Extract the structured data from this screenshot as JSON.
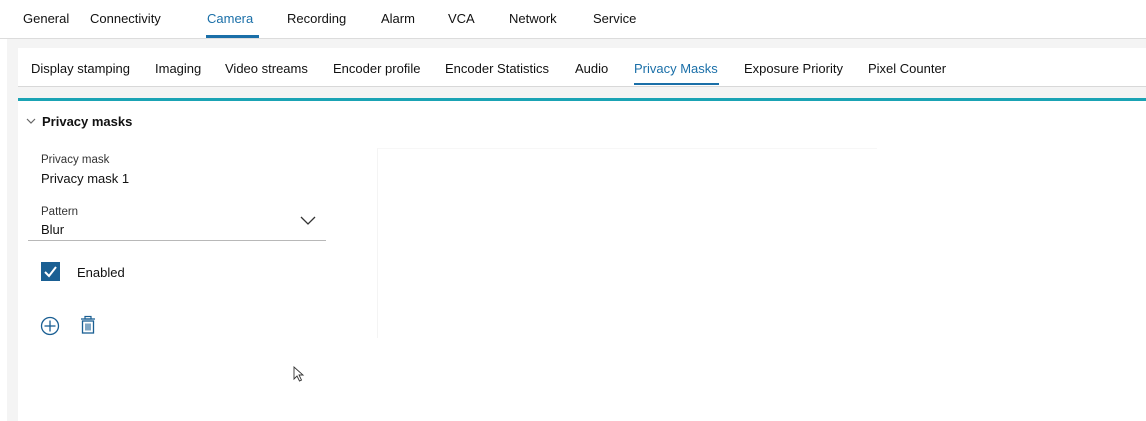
{
  "top_nav": {
    "tabs": [
      "General",
      "Connectivity",
      "Camera",
      "Recording",
      "Alarm",
      "VCA",
      "Network",
      "Service"
    ],
    "active": "Camera"
  },
  "sub_nav": {
    "tabs": [
      "Display stamping",
      "Imaging",
      "Video streams",
      "Encoder profile",
      "Encoder Statistics",
      "Audio",
      "Privacy Masks",
      "Exposure Priority",
      "Pixel Counter"
    ],
    "active": "Privacy Masks"
  },
  "section": {
    "title": "Privacy masks",
    "expanded": true
  },
  "privacy_mask": {
    "label": "Privacy mask",
    "value": "Privacy mask 1"
  },
  "pattern": {
    "label": "Pattern",
    "value": "Blur"
  },
  "enabled": {
    "label": "Enabled",
    "checked": true
  },
  "actions": {
    "add_icon": "plus-circle-icon",
    "delete_icon": "trash-icon"
  },
  "colors": {
    "accent": "#1a6fa8",
    "teal_border": "#1aa3b4",
    "checkbox": "#1a5f93"
  }
}
